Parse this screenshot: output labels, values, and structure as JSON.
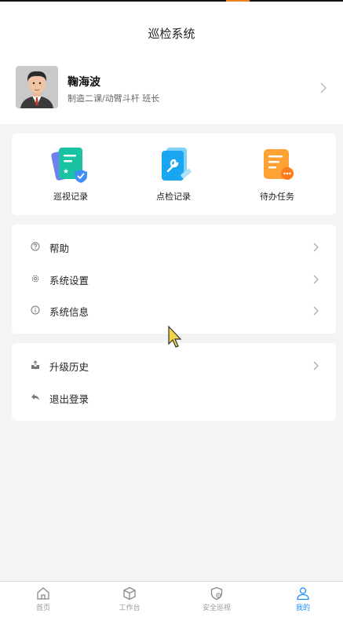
{
  "header": {
    "title": "巡检系统"
  },
  "profile": {
    "name": "鞠海波",
    "department": "制造二课/动臂斗杆 班长"
  },
  "quick_actions": [
    {
      "label": "巡视记录",
      "icon": "patrol-record-icon"
    },
    {
      "label": "点检记录",
      "icon": "spot-check-record-icon"
    },
    {
      "label": "待办任务",
      "icon": "todo-task-icon"
    }
  ],
  "menu_group1": [
    {
      "label": "帮助",
      "icon": "help-icon"
    },
    {
      "label": "系统设置",
      "icon": "gear-icon"
    },
    {
      "label": "系统信息",
      "icon": "info-icon"
    }
  ],
  "menu_group2": [
    {
      "label": "升级历史",
      "icon": "upgrade-history-icon"
    },
    {
      "label": "退出登录",
      "icon": "logout-icon"
    }
  ],
  "tabbar": {
    "tabs": [
      {
        "label": "首页",
        "icon": "home-icon"
      },
      {
        "label": "工作台",
        "icon": "workbench-icon"
      },
      {
        "label": "安全巡视",
        "icon": "shield-icon"
      },
      {
        "label": "我的",
        "icon": "user-icon"
      }
    ],
    "active": "我的"
  },
  "colors": {
    "accent": "#1a8cff",
    "teal": "#19c2a2",
    "blue": "#1aa5f0",
    "orange": "#ffa236",
    "background": "#f4f4f4"
  }
}
